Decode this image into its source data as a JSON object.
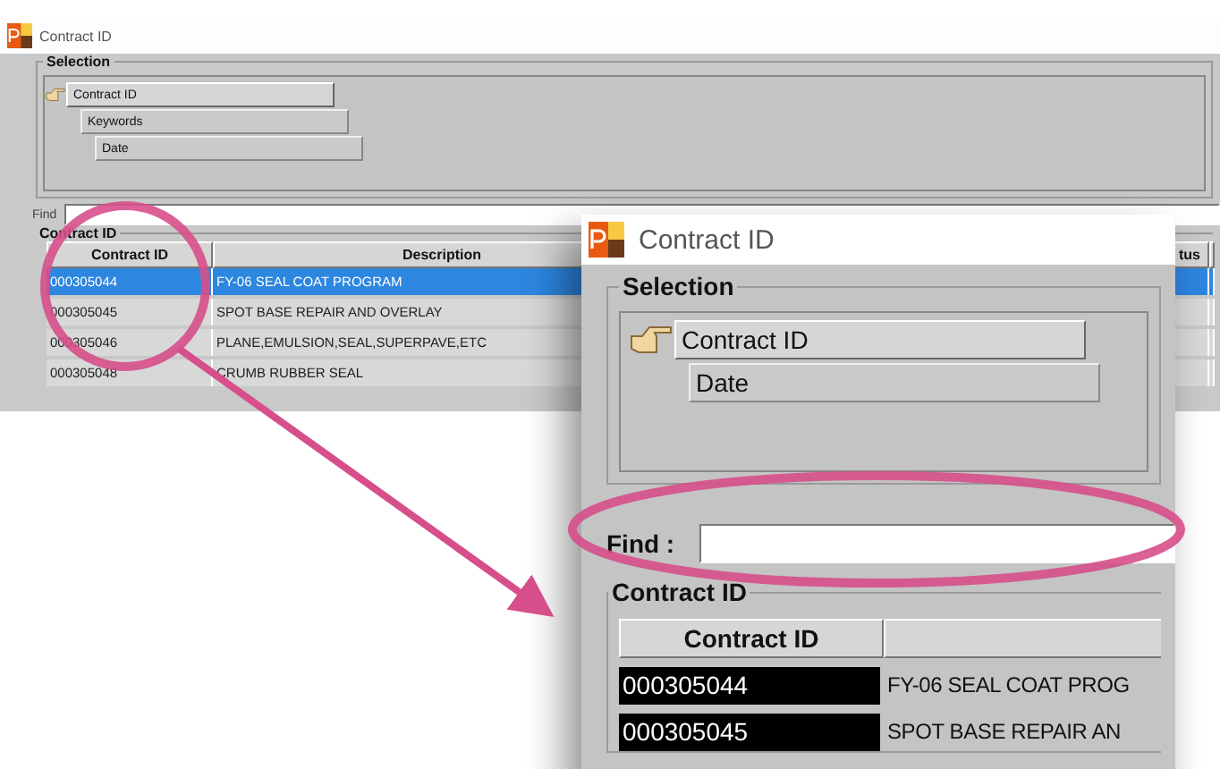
{
  "background_window": {
    "title": "Contract ID",
    "selection": {
      "label": "Selection",
      "options": [
        {
          "label": "Contract ID",
          "selected": true
        },
        {
          "label": "Keywords",
          "selected": false
        },
        {
          "label": "Date",
          "selected": false
        }
      ]
    },
    "find": {
      "label": "Find"
    },
    "group_label": "Contract ID",
    "table": {
      "columns": [
        "Contract ID",
        "Description",
        "tus"
      ],
      "rows": [
        {
          "cells": [
            "000305044",
            "FY-06 SEAL COAT PROGRAM"
          ],
          "selected": true
        },
        {
          "cells": [
            "000305045",
            "SPOT BASE REPAIR AND OVERLAY"
          ],
          "selected": false
        },
        {
          "cells": [
            "000305046",
            "PLANE,EMULSION,SEAL,SUPERPAVE,ETC"
          ],
          "selected": false
        },
        {
          "cells": [
            "000305048",
            "CRUMB RUBBER SEAL"
          ],
          "selected": false
        }
      ]
    }
  },
  "dialog": {
    "title": "Contract ID",
    "selection": {
      "label": "Selection",
      "options": [
        {
          "label": "Contract ID",
          "selected": true
        },
        {
          "label": "Date",
          "selected": false
        }
      ]
    },
    "find": {
      "label": "Find :"
    },
    "group_label": "Contract ID",
    "table": {
      "columns": [
        "Contract ID"
      ],
      "rows": [
        {
          "cells": [
            "000305044",
            "FY-06 SEAL COAT PROG"
          ]
        },
        {
          "cells": [
            "000305045",
            "SPOT BASE REPAIR AN"
          ]
        }
      ]
    }
  }
}
